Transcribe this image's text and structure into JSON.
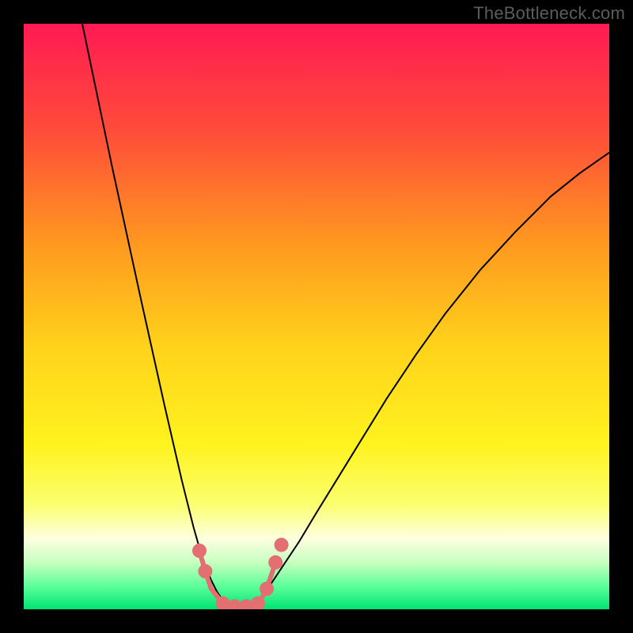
{
  "watermark": {
    "text": "TheBottleneck.com"
  },
  "chart_data": {
    "type": "line",
    "title": "",
    "xlabel": "",
    "ylabel": "",
    "xlim": [
      0,
      100
    ],
    "ylim": [
      0,
      100
    ],
    "grid": false,
    "legend": false,
    "background_gradient": {
      "stops": [
        {
          "offset": 0.0,
          "color": "#ff1a54"
        },
        {
          "offset": 0.18,
          "color": "#ff4b3a"
        },
        {
          "offset": 0.38,
          "color": "#ff9a1f"
        },
        {
          "offset": 0.55,
          "color": "#ffd21b"
        },
        {
          "offset": 0.72,
          "color": "#fff31f"
        },
        {
          "offset": 0.82,
          "color": "#fbff6e"
        },
        {
          "offset": 0.88,
          "color": "#fdffe0"
        },
        {
          "offset": 0.92,
          "color": "#c7ffc0"
        },
        {
          "offset": 0.96,
          "color": "#5eff9a"
        },
        {
          "offset": 1.0,
          "color": "#00e472"
        }
      ]
    },
    "series": [
      {
        "name": "left-branch",
        "stroke": "#000000",
        "stroke_width": 2,
        "x": [
          10.0,
          12.5,
          15.0,
          17.5,
          20.0,
          22.0,
          24.0,
          25.5,
          27.0,
          28.0,
          29.0,
          30.0,
          31.0,
          32.0,
          33.0,
          34.0
        ],
        "y": [
          100.0,
          88.0,
          76.0,
          64.5,
          53.0,
          44.0,
          35.0,
          28.5,
          22.0,
          18.0,
          14.0,
          10.5,
          7.5,
          5.0,
          3.0,
          1.5
        ]
      },
      {
        "name": "right-branch",
        "stroke": "#000000",
        "stroke_width": 2,
        "x": [
          40.0,
          42.0,
          44.0,
          47.0,
          50.0,
          54.0,
          58.0,
          62.0,
          67.0,
          72.0,
          78.0,
          84.0,
          90.0,
          95.0,
          100.0
        ],
        "y": [
          1.5,
          4.0,
          7.0,
          11.5,
          16.5,
          23.0,
          29.5,
          36.0,
          43.5,
          50.5,
          58.0,
          64.5,
          70.5,
          74.5,
          78.0
        ]
      }
    ],
    "flat_bottom": {
      "name": "valley-floor",
      "stroke": "#e46f73",
      "stroke_width": 6,
      "x": [
        30.0,
        31.0,
        32.0,
        34.0,
        36.0,
        38.0,
        40.0,
        41.0,
        42.0,
        43.0
      ],
      "y": [
        10.0,
        6.5,
        3.5,
        1.0,
        0.5,
        0.5,
        1.0,
        2.5,
        5.0,
        8.0
      ]
    },
    "markers": {
      "name": "valley-dots",
      "color": "#e46f73",
      "radius": 9,
      "points": [
        {
          "x": 30.0,
          "y": 10.0
        },
        {
          "x": 31.0,
          "y": 6.5
        },
        {
          "x": 34.0,
          "y": 1.0
        },
        {
          "x": 36.0,
          "y": 0.5
        },
        {
          "x": 38.0,
          "y": 0.5
        },
        {
          "x": 40.0,
          "y": 1.0
        },
        {
          "x": 41.5,
          "y": 3.5
        },
        {
          "x": 43.0,
          "y": 8.0
        },
        {
          "x": 44.0,
          "y": 11.0
        }
      ]
    }
  }
}
